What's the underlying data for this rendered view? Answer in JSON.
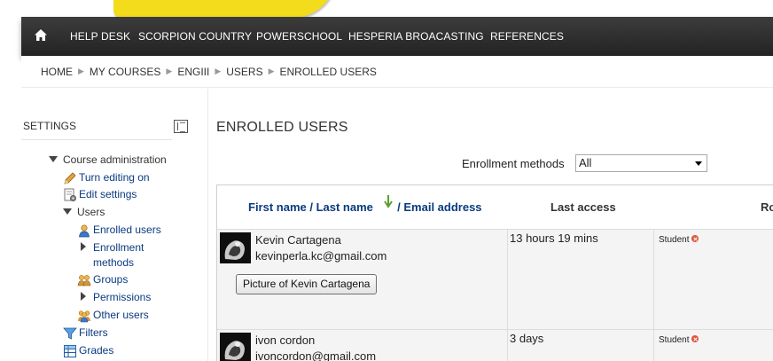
{
  "nav": {
    "items": [
      "HELP DESK",
      "SCORPION COUNTRY",
      "POWERSCHOOL",
      "HESPERIA BROACASTING",
      "REFERENCES"
    ]
  },
  "breadcrumb": [
    "HOME",
    "MY COURSES",
    "ENGIII",
    "USERS",
    "ENROLLED USERS"
  ],
  "sidebar": {
    "title": "SETTINGS",
    "course_admin": "Course administration",
    "turn_editing": "Turn editing on",
    "edit_settings": "Edit settings",
    "users": "Users",
    "enrolled_users": "Enrolled users",
    "enrollment_methods_1": "Enrollment",
    "enrollment_methods_2": "methods",
    "groups": "Groups",
    "permissions": "Permissions",
    "other_users": "Other users",
    "filters": "Filters",
    "grades": "Grades"
  },
  "main": {
    "title": "ENROLLED USERS",
    "enroll_label": "Enrollment methods",
    "enroll_selected": "All"
  },
  "table": {
    "col_first": "First name",
    "col_sep1": " / ",
    "col_last": "Last name",
    "col_sep2": " / ",
    "col_email": "Email address",
    "col_access": "Last access",
    "col_roles": "Ro"
  },
  "rows": [
    {
      "name": "Kevin Cartagena",
      "email": "kevinperla.kc@gmail.com",
      "access": "13 hours 19 mins",
      "role": "Student",
      "picture_button": "Picture of Kevin Cartagena"
    },
    {
      "name": "ivon cordon",
      "email": "ivoncordon@gmail.com",
      "access": "3 days",
      "role": "Student"
    }
  ],
  "colors": {
    "navbar": "#2e2e2e",
    "link": "#0a3a80",
    "logo_yellow": "#f3dc1c",
    "remove_icon": "#e0553c",
    "sort_arrow": "#5aa02c"
  }
}
